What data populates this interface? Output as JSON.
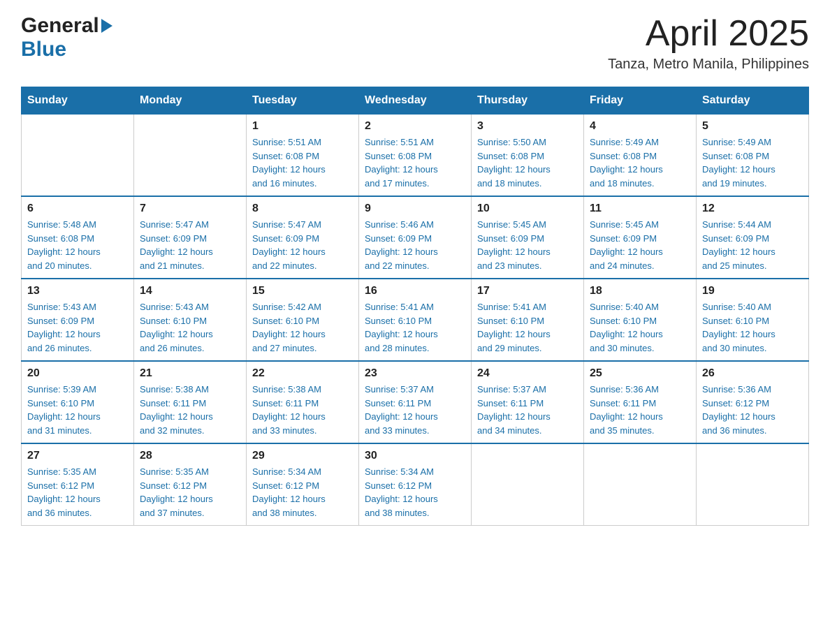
{
  "header": {
    "month_title": "April 2025",
    "location": "Tanza, Metro Manila, Philippines",
    "logo_general": "General",
    "logo_blue": "Blue"
  },
  "weekdays": [
    "Sunday",
    "Monday",
    "Tuesday",
    "Wednesday",
    "Thursday",
    "Friday",
    "Saturday"
  ],
  "weeks": [
    {
      "days": [
        {
          "number": "",
          "info": ""
        },
        {
          "number": "",
          "info": ""
        },
        {
          "number": "1",
          "info": "Sunrise: 5:51 AM\nSunset: 6:08 PM\nDaylight: 12 hours\nand 16 minutes."
        },
        {
          "number": "2",
          "info": "Sunrise: 5:51 AM\nSunset: 6:08 PM\nDaylight: 12 hours\nand 17 minutes."
        },
        {
          "number": "3",
          "info": "Sunrise: 5:50 AM\nSunset: 6:08 PM\nDaylight: 12 hours\nand 18 minutes."
        },
        {
          "number": "4",
          "info": "Sunrise: 5:49 AM\nSunset: 6:08 PM\nDaylight: 12 hours\nand 18 minutes."
        },
        {
          "number": "5",
          "info": "Sunrise: 5:49 AM\nSunset: 6:08 PM\nDaylight: 12 hours\nand 19 minutes."
        }
      ]
    },
    {
      "days": [
        {
          "number": "6",
          "info": "Sunrise: 5:48 AM\nSunset: 6:08 PM\nDaylight: 12 hours\nand 20 minutes."
        },
        {
          "number": "7",
          "info": "Sunrise: 5:47 AM\nSunset: 6:09 PM\nDaylight: 12 hours\nand 21 minutes."
        },
        {
          "number": "8",
          "info": "Sunrise: 5:47 AM\nSunset: 6:09 PM\nDaylight: 12 hours\nand 22 minutes."
        },
        {
          "number": "9",
          "info": "Sunrise: 5:46 AM\nSunset: 6:09 PM\nDaylight: 12 hours\nand 22 minutes."
        },
        {
          "number": "10",
          "info": "Sunrise: 5:45 AM\nSunset: 6:09 PM\nDaylight: 12 hours\nand 23 minutes."
        },
        {
          "number": "11",
          "info": "Sunrise: 5:45 AM\nSunset: 6:09 PM\nDaylight: 12 hours\nand 24 minutes."
        },
        {
          "number": "12",
          "info": "Sunrise: 5:44 AM\nSunset: 6:09 PM\nDaylight: 12 hours\nand 25 minutes."
        }
      ]
    },
    {
      "days": [
        {
          "number": "13",
          "info": "Sunrise: 5:43 AM\nSunset: 6:09 PM\nDaylight: 12 hours\nand 26 minutes."
        },
        {
          "number": "14",
          "info": "Sunrise: 5:43 AM\nSunset: 6:10 PM\nDaylight: 12 hours\nand 26 minutes."
        },
        {
          "number": "15",
          "info": "Sunrise: 5:42 AM\nSunset: 6:10 PM\nDaylight: 12 hours\nand 27 minutes."
        },
        {
          "number": "16",
          "info": "Sunrise: 5:41 AM\nSunset: 6:10 PM\nDaylight: 12 hours\nand 28 minutes."
        },
        {
          "number": "17",
          "info": "Sunrise: 5:41 AM\nSunset: 6:10 PM\nDaylight: 12 hours\nand 29 minutes."
        },
        {
          "number": "18",
          "info": "Sunrise: 5:40 AM\nSunset: 6:10 PM\nDaylight: 12 hours\nand 30 minutes."
        },
        {
          "number": "19",
          "info": "Sunrise: 5:40 AM\nSunset: 6:10 PM\nDaylight: 12 hours\nand 30 minutes."
        }
      ]
    },
    {
      "days": [
        {
          "number": "20",
          "info": "Sunrise: 5:39 AM\nSunset: 6:10 PM\nDaylight: 12 hours\nand 31 minutes."
        },
        {
          "number": "21",
          "info": "Sunrise: 5:38 AM\nSunset: 6:11 PM\nDaylight: 12 hours\nand 32 minutes."
        },
        {
          "number": "22",
          "info": "Sunrise: 5:38 AM\nSunset: 6:11 PM\nDaylight: 12 hours\nand 33 minutes."
        },
        {
          "number": "23",
          "info": "Sunrise: 5:37 AM\nSunset: 6:11 PM\nDaylight: 12 hours\nand 33 minutes."
        },
        {
          "number": "24",
          "info": "Sunrise: 5:37 AM\nSunset: 6:11 PM\nDaylight: 12 hours\nand 34 minutes."
        },
        {
          "number": "25",
          "info": "Sunrise: 5:36 AM\nSunset: 6:11 PM\nDaylight: 12 hours\nand 35 minutes."
        },
        {
          "number": "26",
          "info": "Sunrise: 5:36 AM\nSunset: 6:12 PM\nDaylight: 12 hours\nand 36 minutes."
        }
      ]
    },
    {
      "days": [
        {
          "number": "27",
          "info": "Sunrise: 5:35 AM\nSunset: 6:12 PM\nDaylight: 12 hours\nand 36 minutes."
        },
        {
          "number": "28",
          "info": "Sunrise: 5:35 AM\nSunset: 6:12 PM\nDaylight: 12 hours\nand 37 minutes."
        },
        {
          "number": "29",
          "info": "Sunrise: 5:34 AM\nSunset: 6:12 PM\nDaylight: 12 hours\nand 38 minutes."
        },
        {
          "number": "30",
          "info": "Sunrise: 5:34 AM\nSunset: 6:12 PM\nDaylight: 12 hours\nand 38 minutes."
        },
        {
          "number": "",
          "info": ""
        },
        {
          "number": "",
          "info": ""
        },
        {
          "number": "",
          "info": ""
        }
      ]
    }
  ]
}
